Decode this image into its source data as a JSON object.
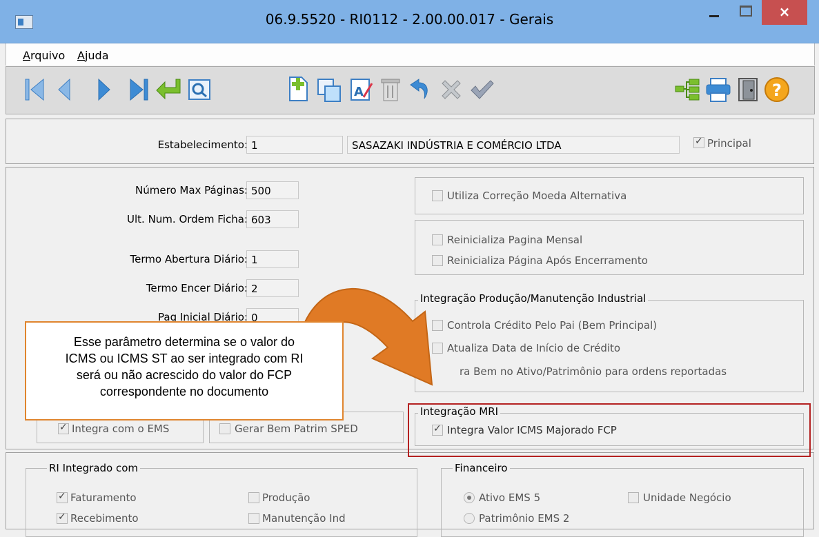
{
  "window": {
    "title": "06.9.5520 - RI0112 - 2.00.00.017 - Gerais",
    "close_label": "×"
  },
  "menu": {
    "items": [
      {
        "label": "Arquivo"
      },
      {
        "label": "Ajuda"
      }
    ]
  },
  "toolbar": {
    "icons": [
      "first-icon",
      "previous-icon",
      "next-icon",
      "last-icon",
      "goto-icon",
      "search-icon",
      "new-icon",
      "copy-icon",
      "edit-icon",
      "delete-icon",
      "undo-icon",
      "cancel-icon",
      "confirm-icon",
      "tree-icon",
      "print-icon",
      "exit-icon",
      "help-icon"
    ]
  },
  "header": {
    "estab_label": "Estabelecimento:",
    "estab_code": "1",
    "estab_name": "SASAZAKI INDÚSTRIA E COMÉRCIO LTDA",
    "principal_label": "Principal",
    "principal_checked": true
  },
  "params": {
    "max_pages_label": "Número Max Páginas:",
    "max_pages_value": "500",
    "ult_num_label": "Ult. Num. Ordem Ficha:",
    "ult_num_value": "603",
    "termo_abertura_label": "Termo Abertura Diário:",
    "termo_abertura_value": "1",
    "termo_encer_label": "Termo Encer Diário:",
    "termo_encer_value": "2",
    "pag_inicial_label": "Pag Inicial Diário:",
    "pag_inicial_value": "0"
  },
  "options": {
    "correcao_moeda": "Utiliza Correção Moeda Alternativa",
    "reinicializa_mensal": "Reinicializa Pagina Mensal",
    "reinicializa_encerramento": "Reinicializa Página Após Encerramento"
  },
  "integracao_producao": {
    "title": "Integração Produção/Manutenção Industrial",
    "controla_credito": "Controla Crédito Pelo Pai (Bem Principal)",
    "atualiza_data": "Atualiza Data de Início de Crédito",
    "gera_bem": "ra Bem no Ativo/Patrimônio para ordens reportadas"
  },
  "integra_ems": {
    "label": "Integra com o EMS",
    "checked": true
  },
  "gerar_bem": {
    "label": "Gerar Bem Patrim SPED",
    "checked": false
  },
  "integracao_mri": {
    "title": "Integração MRI",
    "integra_valor": "Integra Valor ICMS Majorado FCP",
    "checked": true
  },
  "ri_integrado": {
    "title": "RI Integrado com",
    "faturamento": "Faturamento",
    "recebimento": "Recebimento",
    "producao": "Produção",
    "manutencao": "Manutenção Ind"
  },
  "financeiro": {
    "title": "Financeiro",
    "ativo": "Ativo EMS 5",
    "patrimonio": "Patrimônio EMS 2",
    "unidade": "Unidade Negócio"
  },
  "callout": {
    "line1": "Esse parâmetro determina se o valor do",
    "line2": "ICMS ou ICMS ST ao ser integrado com RI",
    "line3": "será ou não acrescido do valor do FCP",
    "line4": "correspondente no documento"
  },
  "colors": {
    "titlebar": "#7fb1e6",
    "close": "#c75050",
    "arrow": "#e07a25",
    "highlight": "#b42121"
  }
}
